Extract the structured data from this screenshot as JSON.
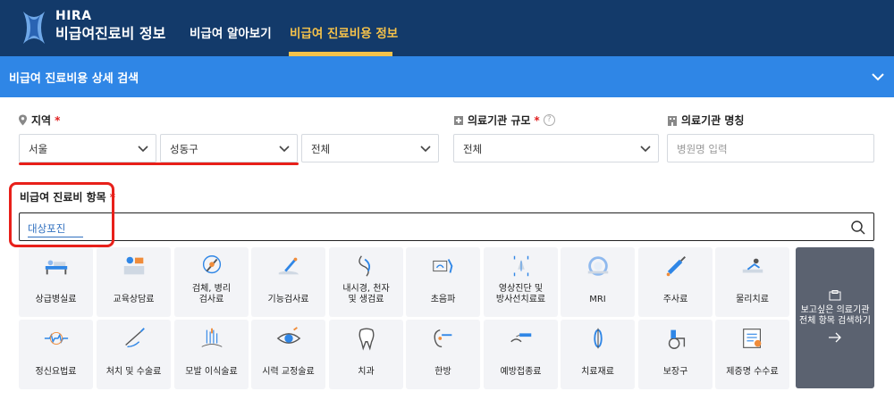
{
  "header": {
    "brand_top": "HIRA",
    "brand_bottom": "비급여진료비 정보",
    "nav": [
      "비급여 알아보기",
      "비급여 진료비용 정보"
    ],
    "active_color": "#f5c24a"
  },
  "search_panel": {
    "title": "비급여 진료비용 상세 검색"
  },
  "region": {
    "label": "지역",
    "required": "*",
    "selects": [
      "서울",
      "성동구",
      "전체"
    ]
  },
  "scale": {
    "label": "의료기관 규모",
    "required": "*",
    "help": "?",
    "value": "전체"
  },
  "hospital_name": {
    "label": "의료기관 명칭",
    "placeholder": "병원명 입력"
  },
  "item": {
    "label": "비급여 진료비 항목",
    "required": "*",
    "value": "대상포진"
  },
  "categories_row1": [
    {
      "label": "상급병실료",
      "icon": "hospital-bed-icon"
    },
    {
      "label": "교육상담료",
      "icon": "counseling-icon"
    },
    {
      "label": "검체, 병리\n검사료",
      "icon": "microscope-icon"
    },
    {
      "label": "기능검사료",
      "icon": "function-test-icon"
    },
    {
      "label": "내시경, 천자\n및 생검료",
      "icon": "endoscope-icon"
    },
    {
      "label": "초음파",
      "icon": "ultrasound-icon"
    },
    {
      "label": "영상진단 및\n방사선치료료",
      "icon": "xray-icon"
    },
    {
      "label": "MRI",
      "icon": "mri-icon"
    },
    {
      "label": "주사료",
      "icon": "syringe-icon"
    },
    {
      "label": "물리치료",
      "icon": "physical-therapy-icon"
    }
  ],
  "categories_row2": [
    {
      "label": "정신요법료",
      "icon": "brain-wave-icon"
    },
    {
      "label": "처치 및 수술료",
      "icon": "surgery-icon"
    },
    {
      "label": "모발 이식술료",
      "icon": "hair-transplant-icon"
    },
    {
      "label": "시력 교정술료",
      "icon": "eye-icon"
    },
    {
      "label": "치과",
      "icon": "tooth-icon"
    },
    {
      "label": "한방",
      "icon": "acupuncture-icon"
    },
    {
      "label": "예방접종료",
      "icon": "vaccine-icon"
    },
    {
      "label": "치료재료",
      "icon": "medical-material-icon"
    },
    {
      "label": "보장구",
      "icon": "wheelchair-icon"
    },
    {
      "label": "제증명 수수료",
      "icon": "certificate-icon"
    }
  ],
  "all_items_button": {
    "label": "보고싶은 의료기관\n전체 항목 검색하기",
    "arrow": "→"
  }
}
